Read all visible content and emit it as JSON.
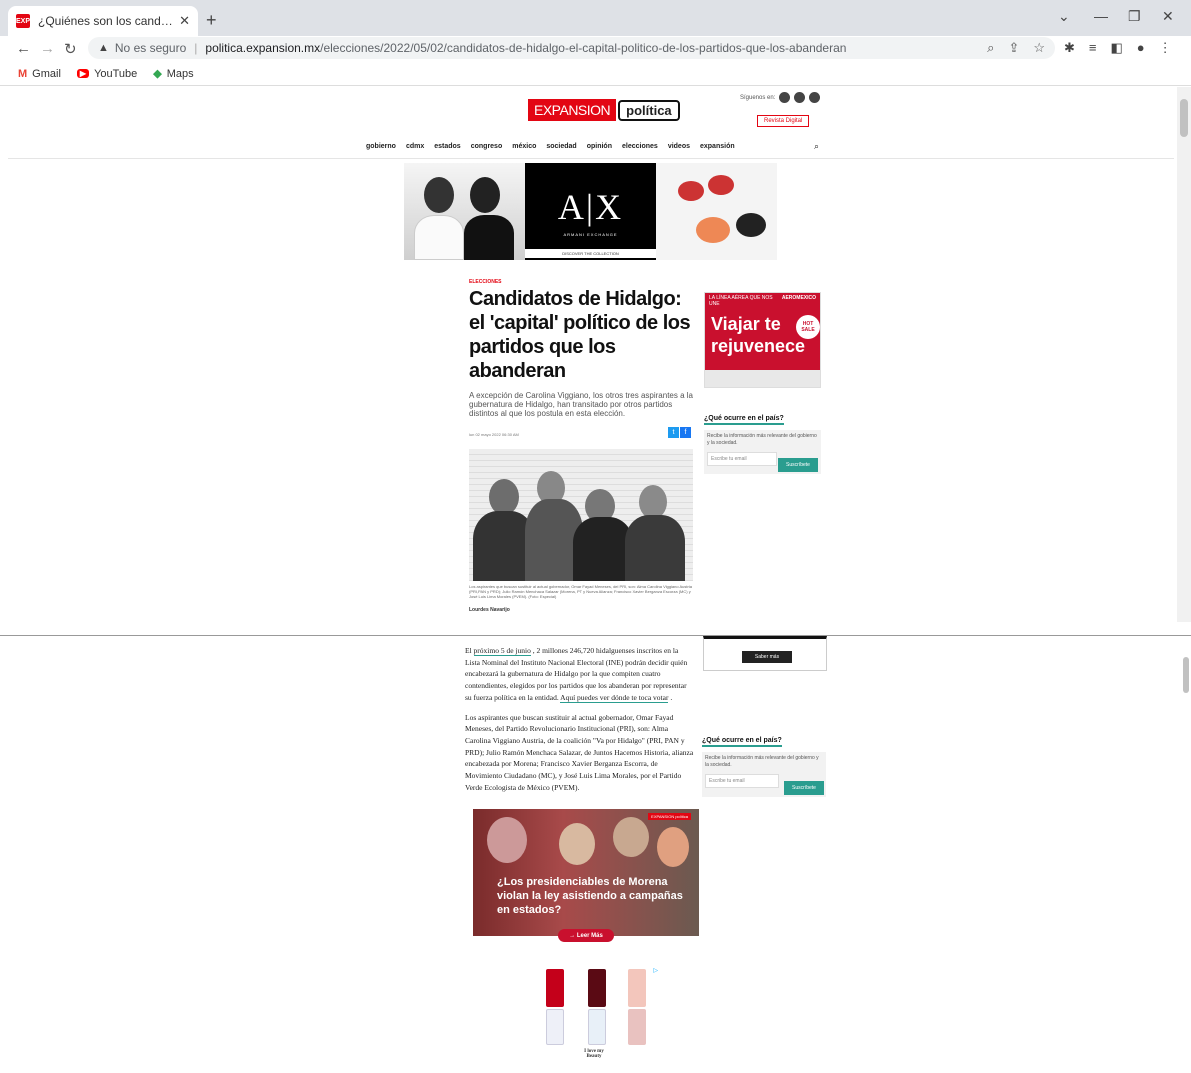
{
  "browser": {
    "tab_title": "¿Quiénes son los candidatos a la",
    "favicon_text": "EXP",
    "not_secure": "No es seguro",
    "url_host": "politica.expansion.mx",
    "url_path": "/elecciones/2022/05/02/candidatos-de-hidalgo-el-capital-politico-de-los-partidos-que-los-abanderan",
    "bookmarks": [
      "Gmail",
      "YouTube",
      "Maps"
    ]
  },
  "site": {
    "logo_brand": "EXPANSION",
    "logo_section": "política",
    "follow_label": "Síguenos en:",
    "revista": "Revista Digital",
    "nav": [
      "gobierno",
      "cdmx",
      "estados",
      "congreso",
      "méxico",
      "sociedad",
      "opinión",
      "elecciones",
      "videos",
      "expansión"
    ]
  },
  "ad_top": {
    "brand": "A|X",
    "brand_sub": "ARMANI EXCHANGE",
    "cta": "DISCOVER THE COLLECTION"
  },
  "article": {
    "category": "ELECCIONES",
    "title": "Candidatos de Hidalgo: el 'capital' político de los partidos que los abanderan",
    "lead": "A excepción de Carolina Viggiano, los otros tres aspirantes a la gubernatura de Hidalgo, han transitado por otros partidos distintos al que los postula en esta elección.",
    "date": "lun 02 mayo 2022 06:30 AM",
    "caption": "Los aspirantes que buscan sustituir al actual gobernador, Omar Fayad Meneses, del PRI, son: Alma Carolina Viggiano Austria (PRI,PAN y PRD); Julio Ramón Menchaca Salazar (Morena, PT y Nueva Alianza; Francisco Xavier Berganza Escorza (MC) y José Luis Lima Morales (PVEM). (Foto: Especial)",
    "author": "Lourdes Navarijo",
    "p1_a": "El ",
    "p1_link1": "próximo 5 de junio",
    "p1_b": " , 2 millones 246,720 hidalguenses inscritos en la Lista Nominal del Instituto Nacional Electoral (INE) podrán decidir quién encabezará la gubernatura de Hidalgo por la que compiten cuatro contendientes, elegidos por los partidos que los abanderan por representar su fuerza política en la entidad. ",
    "p1_link2": "Aquí puedes ver dónde te toca votar",
    "p1_c": " .",
    "p2": "Los aspirantes que buscan sustituir al actual gobernador, Omar Fayad Meneses, del Partido Revolucionario Institucional (PRI), son: Alma Carolina Viggiano Austria, de la coalición \"Va por Hidalgo\" (PRI, PAN y PRD); Julio Ramón Menchaca Salazar, de Juntos Hacemos Historia, alianza encabezada por Morena; Francisco Xavier Berganza Escorra, de Movimiento Ciudadano (MC), y José Luis Lima Morales, por el Partido Verde Ecologista de México (PVEM)."
  },
  "ad_right": {
    "top_left": "LA LÍNEA AÉREA QUE NOS UNE",
    "brand": "AEROMEXICO",
    "headline": "Viajar te rejuvenece",
    "badge": "HOT SALE"
  },
  "sidebar": {
    "heading": "¿Qué ocurre en el país?",
    "text": "Recibe la información más relevante del gobierno y la sociedad.",
    "input_placeholder": "Escribe tu email",
    "button": "Suscríbete",
    "saber": "Saber más"
  },
  "promo": {
    "badge": "EXPANSION política",
    "text": "¿Los presidenciables de Morena violan la ley asistiendo a campañas en estados?",
    "cta": "→ Leer Más"
  },
  "ad_bottom": {
    "brand": "I love my Beauty"
  }
}
